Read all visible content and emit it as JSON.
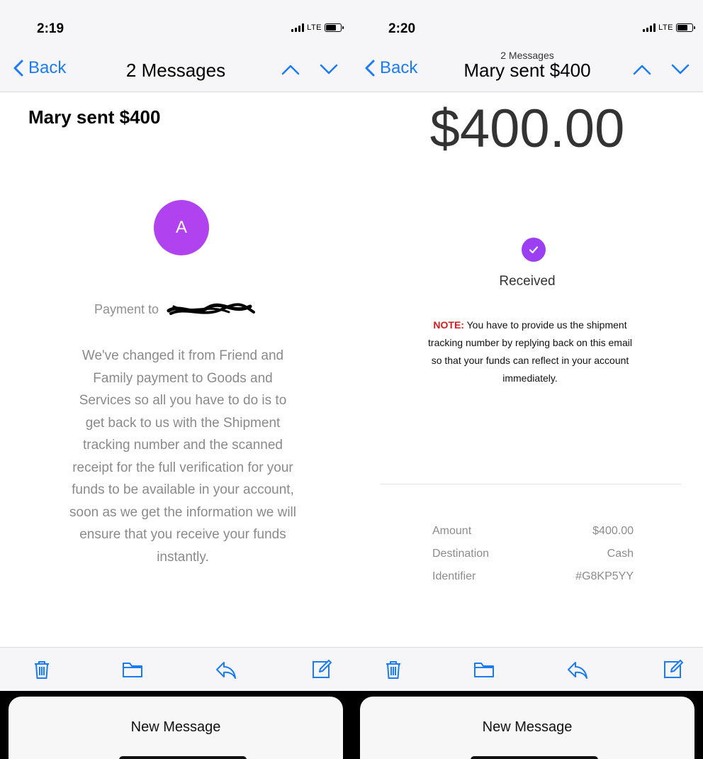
{
  "left": {
    "status": {
      "time": "2:19",
      "network": "LTE"
    },
    "nav": {
      "back_label": "Back",
      "title": "2 Messages"
    },
    "subject": "Mary sent $400",
    "avatar_letter": "A",
    "payment_to_label": "Payment to",
    "body": "We've changed it from Friend and Family payment to Goods and Services so all you have to do is to get back to us with the Shipment tracking number and the scanned receipt for the full verification for your funds to be available in your account, soon as we get the information we will ensure that you receive your funds instantly.",
    "new_message": "New Message"
  },
  "right": {
    "status": {
      "time": "2:20",
      "network": "LTE"
    },
    "nav": {
      "back_label": "Back",
      "subtitle": "2 Messages",
      "title": "Mary sent $400"
    },
    "amount": "$400.00",
    "status_label": "Received",
    "note_label": "NOTE:",
    "note_text": "You have to provide us the shipment tracking number by replying back on this email so that your funds can reflect in your account immediately.",
    "details": [
      {
        "label": "Amount",
        "value": "$400.00"
      },
      {
        "label": "Destination",
        "value": "Cash"
      },
      {
        "label": "Identifier",
        "value": "#G8KP5YY"
      }
    ],
    "new_message": "New Message"
  },
  "colors": {
    "accent": "#1a7cf5",
    "avatar": "#b042f0",
    "check": "#9c3ef2",
    "note_red": "#d21e1e"
  },
  "icons": [
    "chevron-left-icon",
    "chevron-up-icon",
    "chevron-down-icon",
    "trash-icon",
    "folder-icon",
    "reply-icon",
    "compose-icon",
    "checkmark-icon"
  ]
}
